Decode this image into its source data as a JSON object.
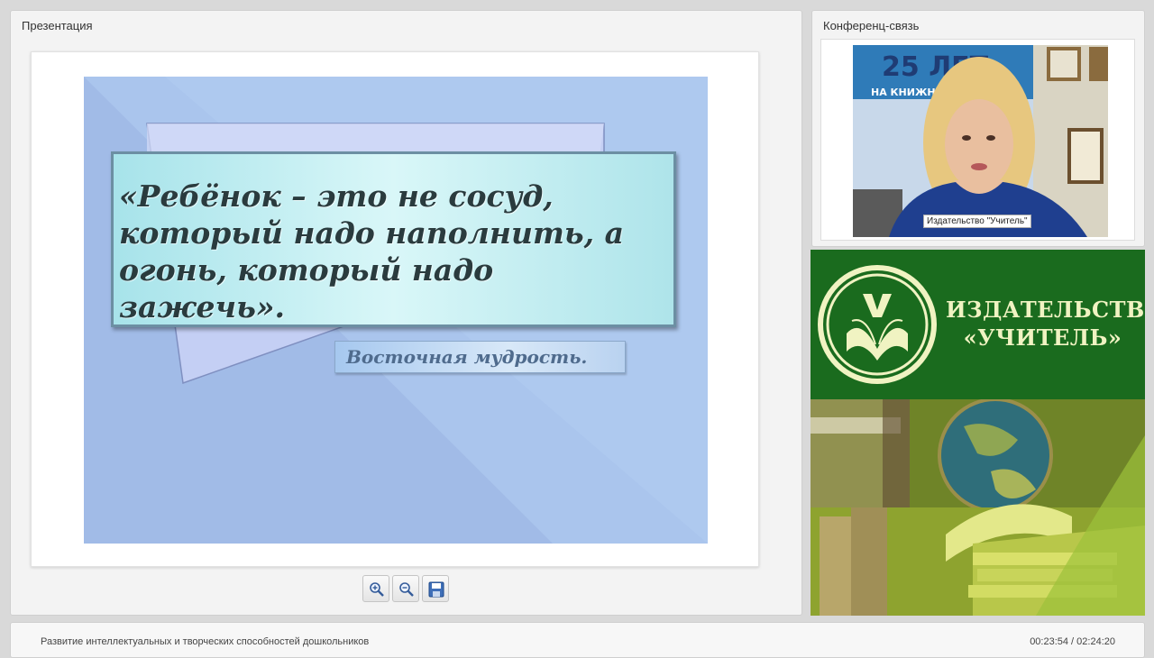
{
  "presentation": {
    "title": "Презентация",
    "slide": {
      "quote": "«Ребёнок – это не сосуд, который надо наполнить, а огонь, который надо зажечь».",
      "attribution": "Восточная мудрость."
    },
    "toolbar": [
      {
        "name": "zoom-in",
        "icon": "zoom-in-icon"
      },
      {
        "name": "zoom-out",
        "icon": "zoom-out-icon"
      },
      {
        "name": "save",
        "icon": "save-icon"
      }
    ]
  },
  "conference": {
    "title": "Конференц-связь",
    "speaker_caption": "Издательство \"Учитель\"",
    "backdrop_text": "25 ЛЕТ",
    "backdrop_subtext": "НА КНИЖНО"
  },
  "banner": {
    "title_line1": "ИЗДАТЕЛЬСТВО",
    "title_line2": "«УЧИТЕЛЬ»",
    "colors": {
      "green": "#1a6b1e",
      "cream": "#f0f3c2"
    }
  },
  "footer": {
    "webinar_title": "Развитие интеллектуальных и творческих способностей дошкольников",
    "time": "00:23:54 / 02:24:20"
  }
}
